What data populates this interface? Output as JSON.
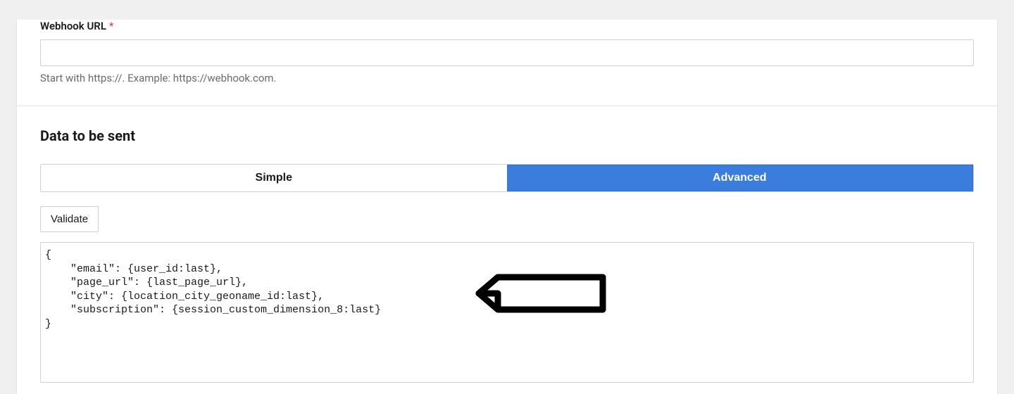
{
  "webhook": {
    "label": "Webhook URL",
    "value": "",
    "helper": "Start with https://. Example: https://webhook.com."
  },
  "data_section": {
    "heading": "Data to be sent",
    "tabs": {
      "simple": "Simple",
      "advanced": "Advanced"
    },
    "validate_label": "Validate",
    "code": "{\n    \"email\": {user_id:last},\n    \"page_url\": {last_page_url},\n    \"city\": {location_city_geoname_id:last},\n    \"subscription\": {session_custom_dimension_8:last}\n}"
  }
}
